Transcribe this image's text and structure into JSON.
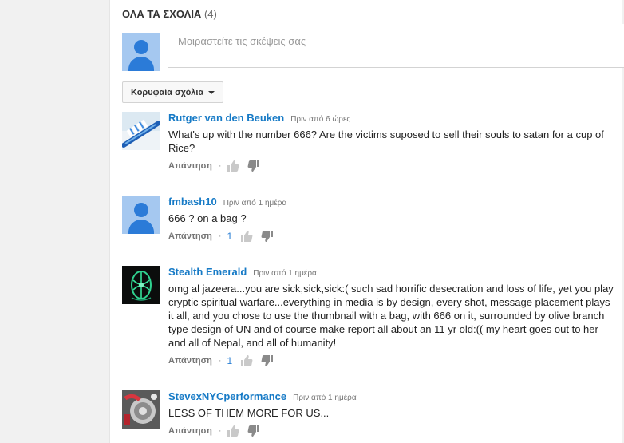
{
  "header": {
    "title": "ΟΛΑ ΤΑ ΣΧΟΛΙΑ",
    "count": "(4)"
  },
  "share": {
    "placeholder": "Μοιραστείτε τις σκέψεις σας"
  },
  "sort": {
    "label": "Κορυφαία σχόλια"
  },
  "comments": [
    {
      "author": "Rutger van den Beuken",
      "time": "Πριν από 6 ώρες",
      "text": "What's up with the number 666? Are the victims suposed to sell their souls to satan for a cup of Rice?",
      "reply": "Απάντηση",
      "likes": ""
    },
    {
      "author": "fmbash10",
      "time": "Πριν από 1 ημέρα",
      "text": "666 ? on a bag ?",
      "reply": "Απάντηση",
      "likes": "1"
    },
    {
      "author": "Stealth Emerald",
      "time": "Πριν από 1 ημέρα",
      "text": "omg al jazeera...you are sick,sick,sick:( such sad horrific desecration and loss of life, yet you play cryptic spiritual warfare...everything in media is by design, every shot, message placement plays it all, and you chose to use the thumbnail with a bag, with 666 on it, surrounded by olive branch type design of UN and of course make report all about an 11 yr old:(( my heart goes out to her and all of Nepal, and all of humanity!",
      "reply": "Απάντηση",
      "likes": "1"
    },
    {
      "author": "StevexNYCperformance",
      "time": "Πριν από 1 ημέρα",
      "text": "LESS OF THEM MORE FOR US...",
      "reply": "Απάντηση",
      "likes": ""
    }
  ],
  "colors": {
    "author": "#167ac6",
    "avatar_bg": "#a5c8f0",
    "avatar_fg": "#2b7bd8"
  }
}
